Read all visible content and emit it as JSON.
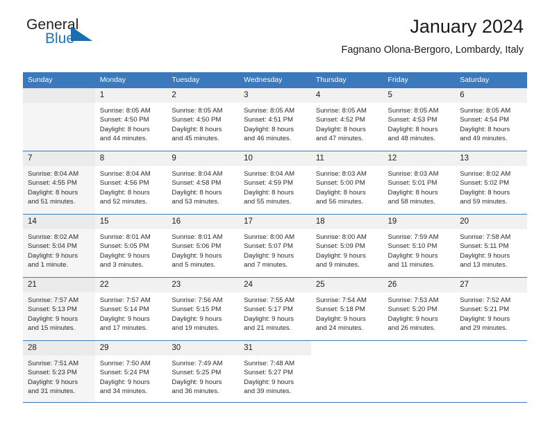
{
  "logo": {
    "word_one": "General",
    "word_two": "Blue",
    "accent_color": "#1b6cb0",
    "triangle_icon": "triangle-right-icon"
  },
  "header": {
    "title": "January 2024",
    "subtitle": "Fagnano Olona-Bergoro, Lombardy, Italy"
  },
  "calendar": {
    "header_bg": "#3b79bd",
    "weekdays": [
      "Sunday",
      "Monday",
      "Tuesday",
      "Wednesday",
      "Thursday",
      "Friday",
      "Saturday"
    ],
    "weeks": [
      [
        {
          "day": "",
          "lines": []
        },
        {
          "day": "1",
          "lines": [
            "Sunrise: 8:05 AM",
            "Sunset: 4:50 PM",
            "Daylight: 8 hours",
            "and 44 minutes."
          ]
        },
        {
          "day": "2",
          "lines": [
            "Sunrise: 8:05 AM",
            "Sunset: 4:50 PM",
            "Daylight: 8 hours",
            "and 45 minutes."
          ]
        },
        {
          "day": "3",
          "lines": [
            "Sunrise: 8:05 AM",
            "Sunset: 4:51 PM",
            "Daylight: 8 hours",
            "and 46 minutes."
          ]
        },
        {
          "day": "4",
          "lines": [
            "Sunrise: 8:05 AM",
            "Sunset: 4:52 PM",
            "Daylight: 8 hours",
            "and 47 minutes."
          ]
        },
        {
          "day": "5",
          "lines": [
            "Sunrise: 8:05 AM",
            "Sunset: 4:53 PM",
            "Daylight: 8 hours",
            "and 48 minutes."
          ]
        },
        {
          "day": "6",
          "lines": [
            "Sunrise: 8:05 AM",
            "Sunset: 4:54 PM",
            "Daylight: 8 hours",
            "and 49 minutes."
          ]
        }
      ],
      [
        {
          "day": "7",
          "lines": [
            "Sunrise: 8:04 AM",
            "Sunset: 4:55 PM",
            "Daylight: 8 hours",
            "and 51 minutes."
          ]
        },
        {
          "day": "8",
          "lines": [
            "Sunrise: 8:04 AM",
            "Sunset: 4:56 PM",
            "Daylight: 8 hours",
            "and 52 minutes."
          ]
        },
        {
          "day": "9",
          "lines": [
            "Sunrise: 8:04 AM",
            "Sunset: 4:58 PM",
            "Daylight: 8 hours",
            "and 53 minutes."
          ]
        },
        {
          "day": "10",
          "lines": [
            "Sunrise: 8:04 AM",
            "Sunset: 4:59 PM",
            "Daylight: 8 hours",
            "and 55 minutes."
          ]
        },
        {
          "day": "11",
          "lines": [
            "Sunrise: 8:03 AM",
            "Sunset: 5:00 PM",
            "Daylight: 8 hours",
            "and 56 minutes."
          ]
        },
        {
          "day": "12",
          "lines": [
            "Sunrise: 8:03 AM",
            "Sunset: 5:01 PM",
            "Daylight: 8 hours",
            "and 58 minutes."
          ]
        },
        {
          "day": "13",
          "lines": [
            "Sunrise: 8:02 AM",
            "Sunset: 5:02 PM",
            "Daylight: 8 hours",
            "and 59 minutes."
          ]
        }
      ],
      [
        {
          "day": "14",
          "lines": [
            "Sunrise: 8:02 AM",
            "Sunset: 5:04 PM",
            "Daylight: 9 hours",
            "and 1 minute."
          ]
        },
        {
          "day": "15",
          "lines": [
            "Sunrise: 8:01 AM",
            "Sunset: 5:05 PM",
            "Daylight: 9 hours",
            "and 3 minutes."
          ]
        },
        {
          "day": "16",
          "lines": [
            "Sunrise: 8:01 AM",
            "Sunset: 5:06 PM",
            "Daylight: 9 hours",
            "and 5 minutes."
          ]
        },
        {
          "day": "17",
          "lines": [
            "Sunrise: 8:00 AM",
            "Sunset: 5:07 PM",
            "Daylight: 9 hours",
            "and 7 minutes."
          ]
        },
        {
          "day": "18",
          "lines": [
            "Sunrise: 8:00 AM",
            "Sunset: 5:09 PM",
            "Daylight: 9 hours",
            "and 9 minutes."
          ]
        },
        {
          "day": "19",
          "lines": [
            "Sunrise: 7:59 AM",
            "Sunset: 5:10 PM",
            "Daylight: 9 hours",
            "and 11 minutes."
          ]
        },
        {
          "day": "20",
          "lines": [
            "Sunrise: 7:58 AM",
            "Sunset: 5:11 PM",
            "Daylight: 9 hours",
            "and 13 minutes."
          ]
        }
      ],
      [
        {
          "day": "21",
          "lines": [
            "Sunrise: 7:57 AM",
            "Sunset: 5:13 PM",
            "Daylight: 9 hours",
            "and 15 minutes."
          ]
        },
        {
          "day": "22",
          "lines": [
            "Sunrise: 7:57 AM",
            "Sunset: 5:14 PM",
            "Daylight: 9 hours",
            "and 17 minutes."
          ]
        },
        {
          "day": "23",
          "lines": [
            "Sunrise: 7:56 AM",
            "Sunset: 5:15 PM",
            "Daylight: 9 hours",
            "and 19 minutes."
          ]
        },
        {
          "day": "24",
          "lines": [
            "Sunrise: 7:55 AM",
            "Sunset: 5:17 PM",
            "Daylight: 9 hours",
            "and 21 minutes."
          ]
        },
        {
          "day": "25",
          "lines": [
            "Sunrise: 7:54 AM",
            "Sunset: 5:18 PM",
            "Daylight: 9 hours",
            "and 24 minutes."
          ]
        },
        {
          "day": "26",
          "lines": [
            "Sunrise: 7:53 AM",
            "Sunset: 5:20 PM",
            "Daylight: 9 hours",
            "and 26 minutes."
          ]
        },
        {
          "day": "27",
          "lines": [
            "Sunrise: 7:52 AM",
            "Sunset: 5:21 PM",
            "Daylight: 9 hours",
            "and 29 minutes."
          ]
        }
      ],
      [
        {
          "day": "28",
          "lines": [
            "Sunrise: 7:51 AM",
            "Sunset: 5:23 PM",
            "Daylight: 9 hours",
            "and 31 minutes."
          ]
        },
        {
          "day": "29",
          "lines": [
            "Sunrise: 7:50 AM",
            "Sunset: 5:24 PM",
            "Daylight: 9 hours",
            "and 34 minutes."
          ]
        },
        {
          "day": "30",
          "lines": [
            "Sunrise: 7:49 AM",
            "Sunset: 5:25 PM",
            "Daylight: 9 hours",
            "and 36 minutes."
          ]
        },
        {
          "day": "31",
          "lines": [
            "Sunrise: 7:48 AM",
            "Sunset: 5:27 PM",
            "Daylight: 9 hours",
            "and 39 minutes."
          ]
        },
        {
          "day": "",
          "lines": []
        },
        {
          "day": "",
          "lines": []
        },
        {
          "day": "",
          "lines": []
        }
      ]
    ]
  }
}
